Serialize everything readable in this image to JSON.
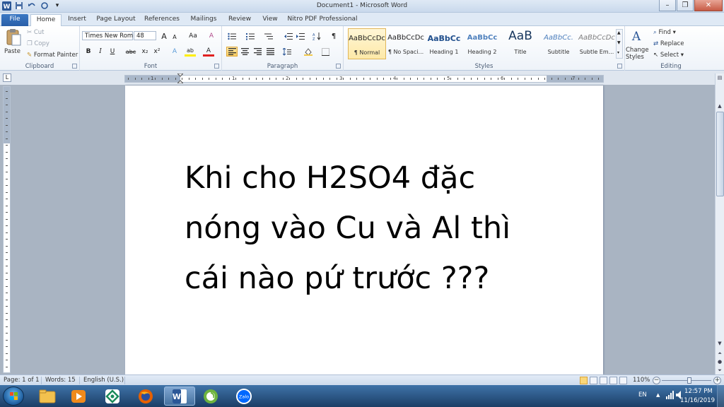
{
  "window": {
    "title": "Document1 - Microsoft Word",
    "controls": {
      "minimize": "–",
      "maximize": "❐",
      "close": "✕"
    },
    "qat": {
      "app_icon": "word-icon",
      "save": "save-icon",
      "undo": "undo-icon",
      "redo": "redo-icon",
      "customize": "▾"
    }
  },
  "tabs": [
    "File",
    "Home",
    "Insert",
    "Page Layout",
    "References",
    "Mailings",
    "Review",
    "View",
    "Nitro PDF Professional"
  ],
  "active_tab": "Home",
  "ribbon": {
    "clipboard": {
      "paste": "Paste",
      "cut": "Cut",
      "copy": "Copy",
      "format_painter": "Format Painter",
      "label": "Clipboard"
    },
    "font": {
      "name": "Times New Rom",
      "size": "48",
      "grow": "A",
      "shrink": "A",
      "change_case": "Aa",
      "clear": "A",
      "bold": "B",
      "italic": "I",
      "underline": "U",
      "strike": "abc",
      "subscript": "x₂",
      "superscript": "x²",
      "effects": "A",
      "highlight": "ab",
      "color": "A",
      "label": "Font"
    },
    "paragraph": {
      "pilcrow": "¶",
      "label": "Paragraph"
    },
    "styles": {
      "items": [
        {
          "sample": "AaBbCcDc",
          "name": "¶ Normal"
        },
        {
          "sample": "AaBbCcDc",
          "name": "¶ No Spaci..."
        },
        {
          "sample": "AaBbCc",
          "name": "Heading 1"
        },
        {
          "sample": "AaBbCc",
          "name": "Heading 2"
        },
        {
          "sample": "AaB",
          "name": "Title"
        },
        {
          "sample": "AaBbCc.",
          "name": "Subtitle"
        },
        {
          "sample": "AaBbCcDc",
          "name": "Subtle Em..."
        }
      ],
      "change_styles_1": "Change",
      "change_styles_2": "Styles",
      "label": "Styles"
    },
    "editing": {
      "find": "Find",
      "replace": "Replace",
      "select": "Select",
      "label": "Editing"
    }
  },
  "ruler": {
    "numbers": [
      "1",
      "1",
      "2",
      "3",
      "4",
      "5",
      "6",
      "7"
    ]
  },
  "document": {
    "lines": [
      "Khi cho H2SO4 đặc",
      "nóng vào Cu và Al thì",
      "cái nào pứ trước ???"
    ]
  },
  "status": {
    "page": "Page: 1 of 1",
    "words": "Words: 15",
    "language": "English (U.S.)",
    "zoom": "110%",
    "zoom_minus": "−",
    "zoom_plus": "+",
    "zoom_level": 0.55
  },
  "taskbar": {
    "apps": [
      "explorer-icon",
      "media-player-icon",
      "app-icon",
      "firefox-icon",
      "word-icon",
      "chrome-like-icon",
      "zalo-icon"
    ],
    "zalo": "Zalo",
    "word": "W",
    "lang": "EN",
    "time": "12:57 PM",
    "date": "11/16/2019"
  },
  "colors": {
    "accent": "#2a5fa8",
    "taskbar": "#1b3e66",
    "selected_style": "#fde9a8"
  }
}
